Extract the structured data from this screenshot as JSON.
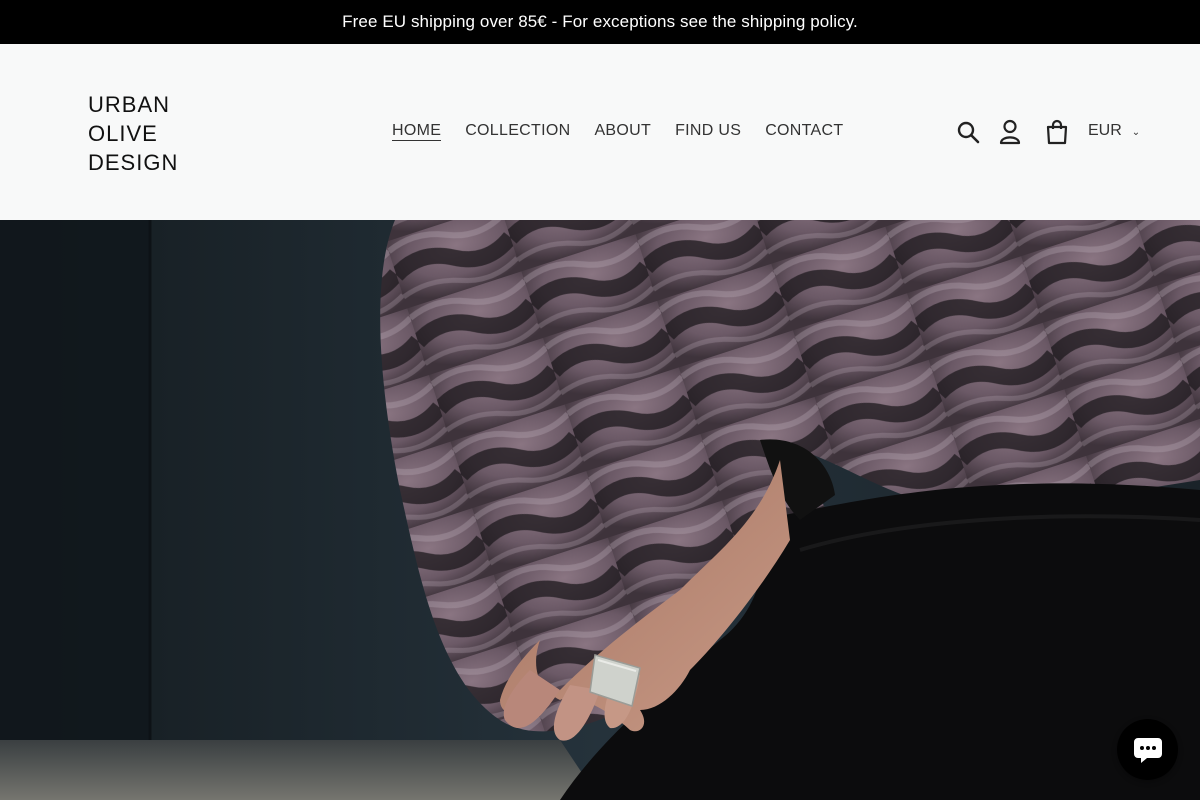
{
  "announcement": {
    "text": "Free EU shipping over 85€ - For exceptions see the shipping policy."
  },
  "logo": {
    "line1": "URBAN",
    "line2": "OLIVE",
    "line3": "DESIGN"
  },
  "nav": {
    "items": [
      {
        "label": "HOME",
        "active": true
      },
      {
        "label": "COLLECTION"
      },
      {
        "label": "ABOUT"
      },
      {
        "label": "FIND US"
      },
      {
        "label": "CONTACT"
      }
    ]
  },
  "header_icons": {
    "search": "search-icon",
    "account": "account-icon",
    "cart": "cart-icon"
  },
  "currency": {
    "selected": "EUR"
  },
  "hero": {
    "image_subject": "fur-coat-hand-ring-photo"
  },
  "chat": {
    "icon": "chat-bubble-icon"
  }
}
